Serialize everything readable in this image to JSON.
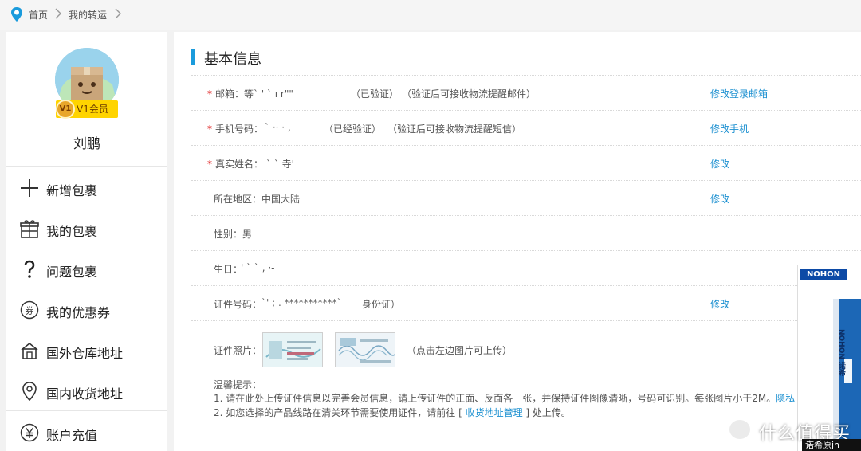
{
  "breadcrumb": {
    "home": "首页",
    "current": "我的转运"
  },
  "user": {
    "vip_badge": "V1会员",
    "vip_level": "V1",
    "name": "刘鹏"
  },
  "sidebar": {
    "items": [
      {
        "label": "新增包裹",
        "icon": "plus-icon"
      },
      {
        "label": "我的包裹",
        "icon": "gift-box-icon"
      },
      {
        "label": "问题包裹",
        "icon": "question-icon"
      },
      {
        "label": "我的优惠券",
        "icon": "coupon-icon"
      },
      {
        "label": "国外仓库地址",
        "icon": "warehouse-icon"
      },
      {
        "label": "国内收货地址",
        "icon": "location-pin-icon"
      },
      {
        "label": "账户充值",
        "icon": "yen-icon"
      }
    ]
  },
  "section": {
    "title": "基本信息"
  },
  "fields": {
    "email": {
      "label": "邮箱：",
      "value": "等`  '  `   ı r\"\"",
      "status": "（已验证）",
      "note": "（验证后可接收物流提醒邮件）",
      "action": "修改登录邮箱"
    },
    "phone": {
      "label": "手机号码：",
      "value": "` ··    ·  ,",
      "status": "（已经验证）",
      "note": "（验证后可接收物流提醒短信）",
      "action": "修改手机"
    },
    "realname": {
      "label": "真实姓名：",
      "value": "` ` 寺'",
      "action": "修改"
    },
    "region": {
      "label": "所在地区：",
      "value": "中国大陆",
      "action": "修改"
    },
    "gender": {
      "label": "性别：",
      "value": "男"
    },
    "birthday": {
      "label": "生日：",
      "value": "' ` ` ,    ·-"
    },
    "idnum": {
      "label": "证件号码：",
      "value": "`' ;  .  ***********` ",
      "suffix": "身份证）",
      "action": "修改"
    },
    "idphoto": {
      "label": "证件照片：",
      "hint": "（点击左边图片可上传）"
    }
  },
  "tips": {
    "title": "温馨提示：",
    "line1": "1. 请在此处上传证件信息以完善会员信息，请上传证件的正面、反面各一张，并保持证件图像清晰，号码可识别。每张图片小于2M。",
    "line1_link": "隐私",
    "line2_pre": "2. 如您选择的产品线路在清关环节需要使用证件，请前往 [ ",
    "line2_link": "收货地址管理",
    "line2_post": " ] 处上传。"
  },
  "ad": {
    "logo": "NOHON",
    "side_text": "NOHON 诺希"
  },
  "watermark": {
    "brand": "什么值得买",
    "overlay": "诺希原jh"
  },
  "colors": {
    "accent": "#1a9bdc",
    "link": "#1a8fd0",
    "verified": "#2aa52a",
    "required": "#e02020",
    "vip": "#ffd400"
  }
}
